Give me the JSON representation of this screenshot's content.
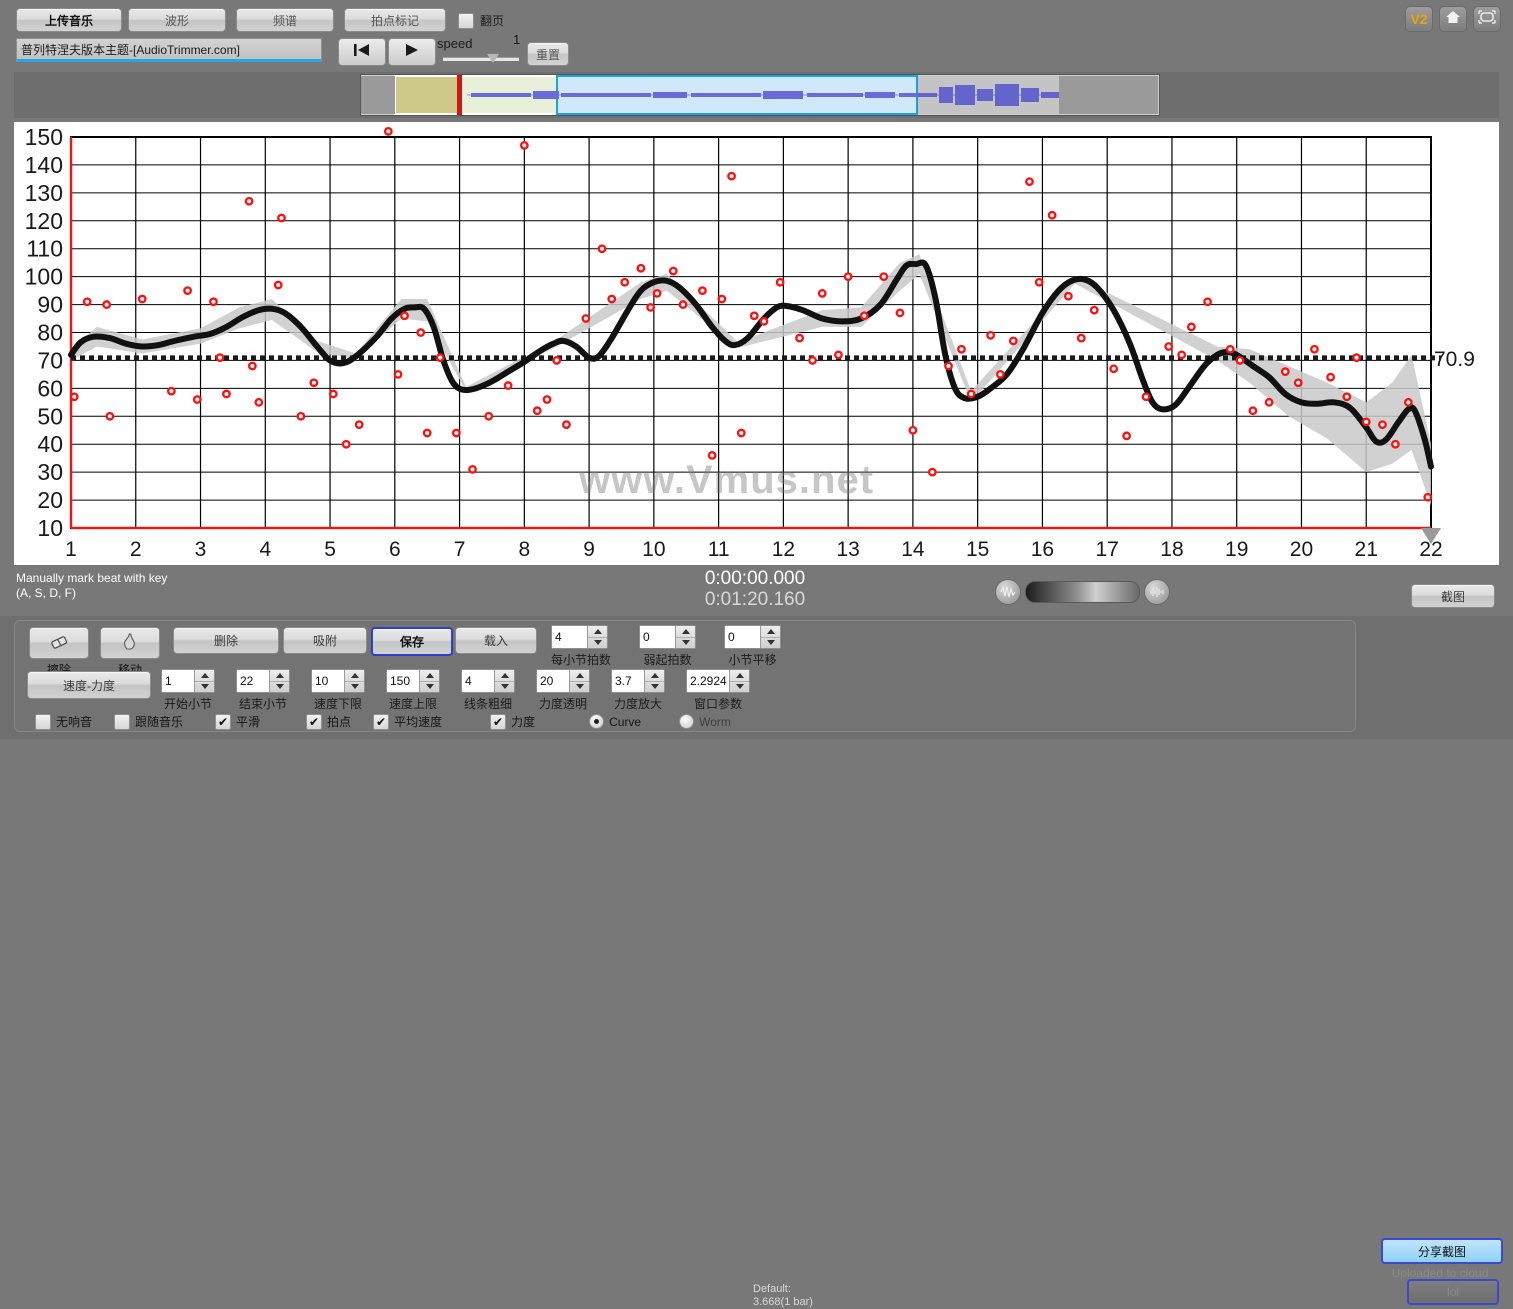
{
  "toolbar": {
    "upload_music": "上传音乐",
    "waveform": "波形",
    "spectrum": "频谱",
    "beat_marker": "拍点标记",
    "page_turn": "翻页",
    "track_title": "普列特涅夫版本主题-[AudioTrimmer.com]",
    "rewind_icon": "rewind-to-start-icon",
    "play_icon": "play-icon",
    "speed_label": "speed",
    "speed_value": "1",
    "reset": "重置",
    "v2_badge": "V2",
    "home_icon": "home-icon",
    "fullscreen_icon": "fullscreen-icon"
  },
  "status": {
    "hint_line1": "Manually mark beat with key",
    "hint_line2": "(A, S, D, F)",
    "time_current": "0:00:00.000",
    "time_total": "0:01:20.160",
    "wave_icon": "waveform-zoom-out-icon",
    "wave_icon2": "waveform-zoom-in-icon"
  },
  "panel": {
    "erase_label": "擦除",
    "move_label": "移动",
    "delete": "删除",
    "snap": "吸附",
    "save": "保存",
    "load": "载入",
    "tempo_dynamics": "速度-力度",
    "spinners_row_top": [
      {
        "value": "4",
        "label": "每小节拍数"
      },
      {
        "value": "0",
        "label": "弱起拍数"
      },
      {
        "value": "0",
        "label": "小节平移"
      }
    ],
    "spinners_row_bottom": [
      {
        "value": "1",
        "label": "开始小节"
      },
      {
        "value": "22",
        "label": "结束小节"
      },
      {
        "value": "10",
        "label": "速度下限"
      },
      {
        "value": "150",
        "label": "速度上限"
      },
      {
        "value": "4",
        "label": "线条粗细"
      },
      {
        "value": "20",
        "label": "力度透明"
      },
      {
        "value": "3.7",
        "label": "力度放大"
      },
      {
        "value": "2.2924",
        "label": "窗口参数"
      }
    ],
    "default_note_line1": "Default:",
    "default_note_line2": "3.668(1 bar)",
    "checkboxes": [
      {
        "label": "无响音",
        "checked": false
      },
      {
        "label": "跟随音乐",
        "checked": false
      },
      {
        "label": "平滑",
        "checked": true
      },
      {
        "label": "拍点",
        "checked": true
      },
      {
        "label": "平均速度",
        "checked": true
      },
      {
        "label": "力度",
        "checked": true
      }
    ],
    "radios": [
      {
        "label": "Curve",
        "selected": true
      },
      {
        "label": "Worm",
        "selected": false
      }
    ]
  },
  "right_panel": {
    "snapshot": "截图",
    "share_snapshot": "分享截图",
    "upload_status": "Uploaded to cloud",
    "lol_button": "lol"
  },
  "chart_data": {
    "type": "line",
    "title": "",
    "watermark": "www.Vmus.net",
    "xlabel": "",
    "ylabel": "",
    "xlim": [
      1,
      22
    ],
    "ylim": [
      10,
      150
    ],
    "xticks": [
      1,
      2,
      3,
      4,
      5,
      6,
      7,
      8,
      9,
      10,
      11,
      12,
      13,
      14,
      15,
      16,
      17,
      18,
      19,
      20,
      21,
      22
    ],
    "yticks": [
      10,
      20,
      30,
      40,
      50,
      60,
      70,
      80,
      90,
      100,
      110,
      120,
      130,
      140,
      150
    ],
    "grid": true,
    "average_line": {
      "value": 70.9,
      "label": "70.9",
      "style": "dashed"
    },
    "series": [
      {
        "name": "tempo-curve",
        "type": "line",
        "color": "#111111",
        "points": [
          [
            1.0,
            72.0
          ],
          [
            1.15,
            76.5
          ],
          [
            1.35,
            78.5
          ],
          [
            1.6,
            78.0
          ],
          [
            1.85,
            76.0
          ],
          [
            2.1,
            75.0
          ],
          [
            2.35,
            75.5
          ],
          [
            2.6,
            77.0
          ],
          [
            2.9,
            78.5
          ],
          [
            3.15,
            79.5
          ],
          [
            3.4,
            82.0
          ],
          [
            3.65,
            85.5
          ],
          [
            3.9,
            88.0
          ],
          [
            4.1,
            88.5
          ],
          [
            4.3,
            87.0
          ],
          [
            4.55,
            82.0
          ],
          [
            4.8,
            75.0
          ],
          [
            5.0,
            70.0
          ],
          [
            5.2,
            69.0
          ],
          [
            5.4,
            71.5
          ],
          [
            5.7,
            78.0
          ],
          [
            5.95,
            85.0
          ],
          [
            6.15,
            88.5
          ],
          [
            6.3,
            89.0
          ],
          [
            6.45,
            88.5
          ],
          [
            6.6,
            82.0
          ],
          [
            6.75,
            70.0
          ],
          [
            6.9,
            62.0
          ],
          [
            7.05,
            59.5
          ],
          [
            7.25,
            60.0
          ],
          [
            7.5,
            62.5
          ],
          [
            7.75,
            66.0
          ],
          [
            8.0,
            69.5
          ],
          [
            8.25,
            73.5
          ],
          [
            8.45,
            76.0
          ],
          [
            8.6,
            77.0
          ],
          [
            8.8,
            75.0
          ],
          [
            9.0,
            71.0
          ],
          [
            9.15,
            71.5
          ],
          [
            9.35,
            78.0
          ],
          [
            9.6,
            88.0
          ],
          [
            9.8,
            95.0
          ],
          [
            10.0,
            98.0
          ],
          [
            10.2,
            98.5
          ],
          [
            10.4,
            96.0
          ],
          [
            10.65,
            90.0
          ],
          [
            10.9,
            82.0
          ],
          [
            11.1,
            77.0
          ],
          [
            11.25,
            75.5
          ],
          [
            11.45,
            78.0
          ],
          [
            11.7,
            85.0
          ],
          [
            11.9,
            89.0
          ],
          [
            12.05,
            89.5
          ],
          [
            12.3,
            88.0
          ],
          [
            12.6,
            85.0
          ],
          [
            12.9,
            84.0
          ],
          [
            13.2,
            85.0
          ],
          [
            13.5,
            90.0
          ],
          [
            13.75,
            99.0
          ],
          [
            13.9,
            104.0
          ],
          [
            14.05,
            104.5
          ],
          [
            14.2,
            104.0
          ],
          [
            14.35,
            92.0
          ],
          [
            14.5,
            72.0
          ],
          [
            14.65,
            60.0
          ],
          [
            14.8,
            56.5
          ],
          [
            15.0,
            57.0
          ],
          [
            15.2,
            60.0
          ],
          [
            15.45,
            65.0
          ],
          [
            15.7,
            74.0
          ],
          [
            16.0,
            87.0
          ],
          [
            16.25,
            95.0
          ],
          [
            16.45,
            98.5
          ],
          [
            16.65,
            99.0
          ],
          [
            16.85,
            96.0
          ],
          [
            17.1,
            88.0
          ],
          [
            17.35,
            76.0
          ],
          [
            17.55,
            63.0
          ],
          [
            17.7,
            55.0
          ],
          [
            17.85,
            52.5
          ],
          [
            18.05,
            54.0
          ],
          [
            18.25,
            60.0
          ],
          [
            18.5,
            68.0
          ],
          [
            18.7,
            72.0
          ],
          [
            18.85,
            73.0
          ],
          [
            19.0,
            72.0
          ],
          [
            19.25,
            68.0
          ],
          [
            19.5,
            64.0
          ],
          [
            19.75,
            58.0
          ],
          [
            20.0,
            55.0
          ],
          [
            20.25,
            54.5
          ],
          [
            20.5,
            55.0
          ],
          [
            20.75,
            53.0
          ],
          [
            21.0,
            46.0
          ],
          [
            21.15,
            41.0
          ],
          [
            21.3,
            41.5
          ],
          [
            21.5,
            48.0
          ],
          [
            21.65,
            52.5
          ],
          [
            21.75,
            52.0
          ],
          [
            21.9,
            42.0
          ],
          [
            22.0,
            32.0
          ]
        ],
        "confidence_band": [
          {
            "x": 1.0,
            "lo": 70.0,
            "hi": 74.0
          },
          {
            "x": 1.4,
            "lo": 75.0,
            "hi": 82.0
          },
          {
            "x": 2.1,
            "lo": 72.5,
            "hi": 77.5
          },
          {
            "x": 3.0,
            "lo": 76.0,
            "hi": 81.5
          },
          {
            "x": 3.6,
            "lo": 81.5,
            "hi": 89.0
          },
          {
            "x": 4.1,
            "lo": 84.5,
            "hi": 92.0
          },
          {
            "x": 4.8,
            "lo": 73.0,
            "hi": 77.0
          },
          {
            "x": 5.4,
            "lo": 70.5,
            "hi": 72.5
          },
          {
            "x": 6.1,
            "lo": 85.0,
            "hi": 92.0
          },
          {
            "x": 6.5,
            "lo": 84.0,
            "hi": 92.0
          },
          {
            "x": 7.1,
            "lo": 59.0,
            "hi": 60.5
          },
          {
            "x": 8.5,
            "lo": 75.0,
            "hi": 77.5
          },
          {
            "x": 9.8,
            "lo": 92.0,
            "hi": 98.0
          },
          {
            "x": 10.2,
            "lo": 95.0,
            "hi": 101.0
          },
          {
            "x": 11.3,
            "lo": 74.5,
            "hi": 76.5
          },
          {
            "x": 12.6,
            "lo": 82.0,
            "hi": 88.0
          },
          {
            "x": 13.2,
            "lo": 82.0,
            "hi": 89.0
          },
          {
            "x": 13.8,
            "lo": 95.0,
            "hi": 105.0
          },
          {
            "x": 14.1,
            "lo": 101.0,
            "hi": 108.0
          },
          {
            "x": 14.9,
            "lo": 55.0,
            "hi": 59.0
          },
          {
            "x": 16.5,
            "lo": 97.5,
            "hi": 100.0
          },
          {
            "x": 18.7,
            "lo": 70.0,
            "hi": 75.0
          },
          {
            "x": 19.2,
            "lo": 62.0,
            "hi": 74.0
          },
          {
            "x": 19.8,
            "lo": 50.0,
            "hi": 68.0
          },
          {
            "x": 20.4,
            "lo": 42.0,
            "hi": 62.0
          },
          {
            "x": 21.0,
            "lo": 30.0,
            "hi": 55.0
          },
          {
            "x": 21.4,
            "lo": 33.0,
            "hi": 62.0
          },
          {
            "x": 21.7,
            "lo": 38.0,
            "hi": 72.0
          },
          {
            "x": 22.0,
            "lo": 18.0,
            "hi": 40.0
          }
        ]
      },
      {
        "name": "beat-points",
        "type": "scatter",
        "color": "#ff1111",
        "points": [
          [
            1.05,
            57.0
          ],
          [
            1.25,
            91.0
          ],
          [
            1.55,
            90.0
          ],
          [
            1.6,
            50.0
          ],
          [
            2.1,
            92.0
          ],
          [
            2.55,
            59.0
          ],
          [
            2.8,
            95.0
          ],
          [
            2.95,
            56.0
          ],
          [
            3.2,
            91.0
          ],
          [
            3.3,
            71.0
          ],
          [
            3.4,
            58.0
          ],
          [
            3.75,
            127.0
          ],
          [
            3.8,
            68.0
          ],
          [
            3.9,
            55.0
          ],
          [
            4.2,
            97.0
          ],
          [
            4.25,
            121.0
          ],
          [
            4.55,
            50.0
          ],
          [
            4.75,
            62.0
          ],
          [
            5.05,
            58.0
          ],
          [
            5.25,
            40.0
          ],
          [
            5.45,
            47.0
          ],
          [
            5.9,
            152.0
          ],
          [
            6.05,
            65.0
          ],
          [
            6.15,
            86.0
          ],
          [
            6.4,
            80.0
          ],
          [
            6.5,
            44.0
          ],
          [
            6.7,
            71.0
          ],
          [
            6.95,
            44.0
          ],
          [
            7.2,
            31.0
          ],
          [
            7.45,
            50.0
          ],
          [
            7.75,
            61.0
          ],
          [
            8.0,
            147.0
          ],
          [
            8.2,
            52.0
          ],
          [
            8.35,
            56.0
          ],
          [
            8.5,
            70.0
          ],
          [
            8.65,
            47.0
          ],
          [
            8.95,
            85.0
          ],
          [
            9.2,
            110.0
          ],
          [
            9.35,
            92.0
          ],
          [
            9.55,
            98.0
          ],
          [
            9.8,
            103.0
          ],
          [
            9.95,
            89.0
          ],
          [
            10.05,
            94.0
          ],
          [
            10.3,
            102.0
          ],
          [
            10.45,
            90.0
          ],
          [
            10.75,
            95.0
          ],
          [
            10.9,
            36.0
          ],
          [
            11.05,
            92.0
          ],
          [
            11.2,
            136.0
          ],
          [
            11.35,
            44.0
          ],
          [
            11.55,
            86.0
          ],
          [
            11.7,
            84.0
          ],
          [
            11.95,
            98.0
          ],
          [
            12.25,
            78.0
          ],
          [
            12.45,
            70.0
          ],
          [
            12.6,
            94.0
          ],
          [
            12.85,
            72.0
          ],
          [
            13.0,
            100.0
          ],
          [
            13.25,
            86.0
          ],
          [
            13.55,
            100.0
          ],
          [
            13.8,
            87.0
          ],
          [
            14.0,
            45.0
          ],
          [
            14.3,
            30.0
          ],
          [
            14.55,
            68.0
          ],
          [
            14.75,
            74.0
          ],
          [
            14.9,
            58.0
          ],
          [
            15.2,
            79.0
          ],
          [
            15.35,
            65.0
          ],
          [
            15.55,
            77.0
          ],
          [
            15.8,
            134.0
          ],
          [
            15.95,
            98.0
          ],
          [
            16.15,
            122.0
          ],
          [
            16.4,
            93.0
          ],
          [
            16.6,
            78.0
          ],
          [
            16.8,
            88.0
          ],
          [
            17.1,
            67.0
          ],
          [
            17.3,
            43.0
          ],
          [
            17.6,
            57.0
          ],
          [
            17.95,
            75.0
          ],
          [
            18.15,
            72.0
          ],
          [
            18.3,
            82.0
          ],
          [
            18.55,
            91.0
          ],
          [
            18.9,
            74.0
          ],
          [
            19.05,
            70.0
          ],
          [
            19.25,
            52.0
          ],
          [
            19.5,
            55.0
          ],
          [
            19.75,
            66.0
          ],
          [
            19.95,
            62.0
          ],
          [
            20.2,
            74.0
          ],
          [
            20.45,
            64.0
          ],
          [
            20.7,
            57.0
          ],
          [
            20.85,
            71.0
          ],
          [
            21.0,
            48.0
          ],
          [
            21.25,
            47.0
          ],
          [
            21.45,
            40.0
          ],
          [
            21.65,
            55.0
          ],
          [
            21.95,
            21.0
          ]
        ]
      }
    ]
  }
}
